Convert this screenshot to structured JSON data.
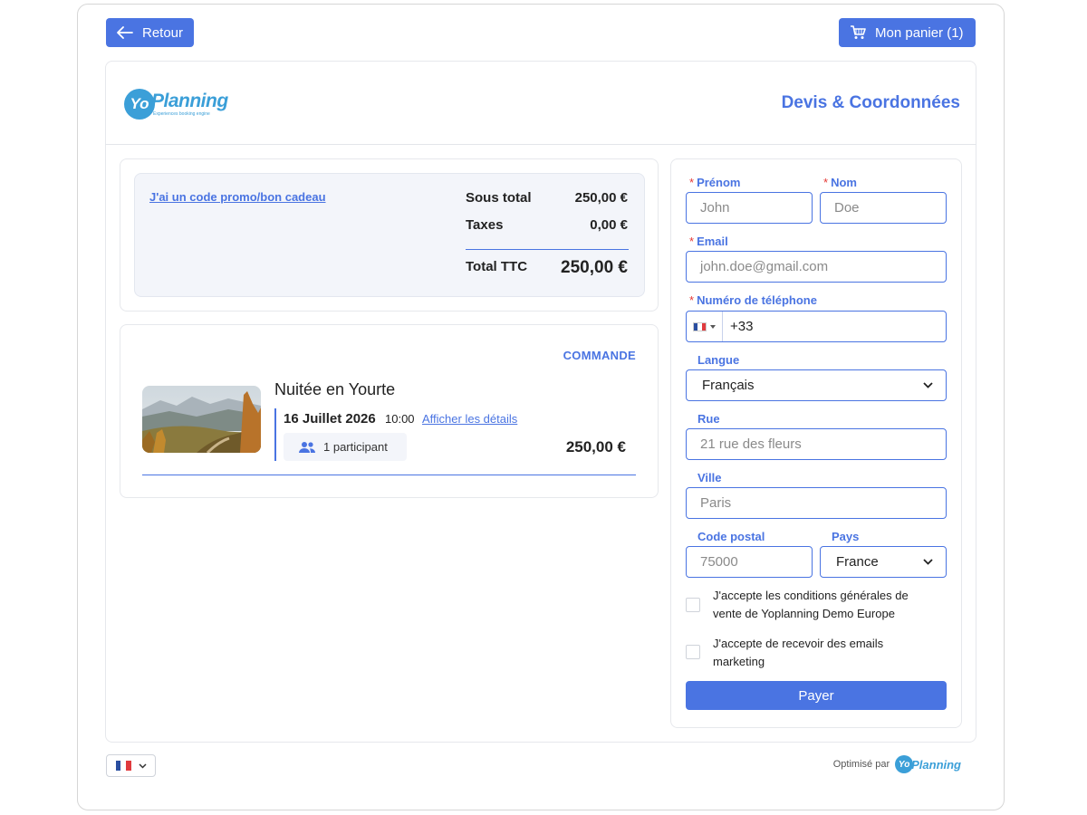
{
  "header": {
    "back_label": "Retour",
    "cart_label": "Mon panier (1)",
    "page_title": "Devis & Coordonnées",
    "logo": {
      "mark": "Yo",
      "name": "Planning",
      "tagline": "Experiences booking engine"
    }
  },
  "summary": {
    "promo_link": "J'ai un code promo/bon cadeau",
    "rows": [
      {
        "label": "Sous total",
        "value": "250,00 €"
      },
      {
        "label": "Taxes",
        "value": "0,00 €"
      }
    ],
    "total_label": "Total TTC",
    "total_value": "250,00 €"
  },
  "order": {
    "heading": "COMMANDE",
    "item": {
      "name": "Nuitée en Yourte",
      "date": "16 Juillet 2026",
      "time": "10:00",
      "details_link": "Afficher les détails",
      "participants": "1 participant",
      "price": "250,00 €"
    }
  },
  "form": {
    "first_name": {
      "label": "Prénom",
      "placeholder": "John",
      "required": "*"
    },
    "last_name": {
      "label": "Nom",
      "placeholder": "Doe",
      "required": "*"
    },
    "email": {
      "label": "Email",
      "placeholder": "john.doe@gmail.com",
      "required": "*"
    },
    "phone": {
      "label": "Numéro de téléphone",
      "value": "+33",
      "required": "*"
    },
    "language": {
      "label": "Langue",
      "value": "Français"
    },
    "street": {
      "label": "Rue",
      "placeholder": "21 rue des fleurs"
    },
    "city": {
      "label": "Ville",
      "placeholder": "Paris"
    },
    "postal_code": {
      "label": "Code postal",
      "placeholder": "75000"
    },
    "country": {
      "label": "Pays",
      "value": "France"
    },
    "terms_checkbox": {
      "label": "J'accepte les conditions générales de vente de Yoplanning Demo Europe",
      "checked": false
    },
    "marketing_checkbox": {
      "label": "J'accepte de recevoir des emails marketing",
      "checked": false
    },
    "pay_label": "Payer"
  },
  "footer": {
    "powered_label": "Optimisé par",
    "mini_logo": {
      "mark": "Yo",
      "name": "Planning"
    }
  },
  "colors": {
    "accent": "#4a74e2",
    "brand": "#3b9fd8",
    "required": "#e53935"
  }
}
